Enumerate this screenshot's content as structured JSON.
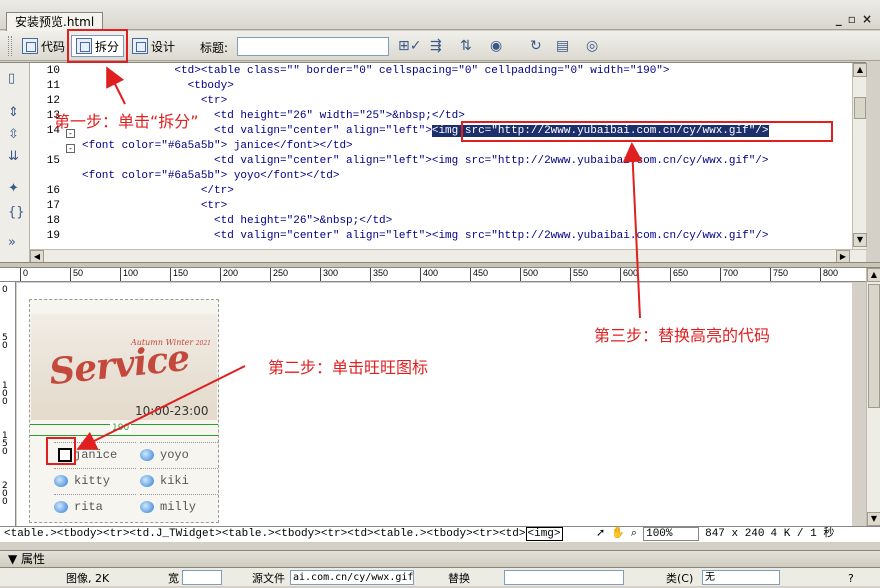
{
  "document": {
    "tab_title": "安装预览.html"
  },
  "window_controls": [
    "_",
    "▫",
    "×"
  ],
  "toolbar": {
    "code_label": "代码",
    "split_label": "拆分",
    "design_label": "设计",
    "title_label": "标题:",
    "title_value": ""
  },
  "code": {
    "lines": [
      {
        "num": "10",
        "text": "              <td><table class=\"\" border=\"0\" cellspacing=\"0\" cellpadding=\"0\" width=\"190\">"
      },
      {
        "num": "11",
        "text": "                <tbody>"
      },
      {
        "num": "12",
        "text": "                  <tr>"
      },
      {
        "num": "13",
        "text": "                    <td height=\"26\" width=\"25\">&nbsp;</td>"
      },
      {
        "num": "14",
        "text": "                    <td valign=\"center\" align=\"left\">",
        "highlight": "<img src=\"http://2www.yubaibai.com.cn/cy/wwx.gif\"/>"
      },
      {
        "num": "",
        "text": "<font color=\"#6a5a5b\"> janice</font></td>"
      },
      {
        "num": "15",
        "text": "                    <td valign=\"center\" align=\"left\"><img src=\"http://2www.yubaibai.com.cn/cy/wwx.gif\"/>"
      },
      {
        "num": "",
        "text": "<font color=\"#6a5a5b\"> yoyo</font></td>"
      },
      {
        "num": "16",
        "text": "                  </tr>"
      },
      {
        "num": "17",
        "text": "                  <tr>"
      },
      {
        "num": "18",
        "text": "                    <td height=\"26\">&nbsp;</td>"
      },
      {
        "num": "19",
        "text": "                    <td valign=\"center\" align=\"left\"><img src=\"http://2www.yubaibai.com.cn/cy/wwx.gif\"/>"
      }
    ]
  },
  "ruler": {
    "marks": [
      "0",
      "50",
      "100",
      "150",
      "200",
      "250",
      "300",
      "350",
      "400",
      "450",
      "500",
      "550",
      "600",
      "650",
      "700",
      "750",
      "800"
    ]
  },
  "ruler_v": {
    "marks": [
      "0",
      "50",
      "100",
      "150",
      "200"
    ]
  },
  "design": {
    "service": {
      "small": "Autumn Winter",
      "small_year": "2021",
      "big": "Service",
      "time": "10:00-23:00"
    },
    "width_label": "190",
    "names": [
      "janice",
      "yoyo",
      "kitty",
      "kiki",
      "rita",
      "milly"
    ]
  },
  "statusbar": {
    "tags": "<table.><tbody><tr><td.J_TWidget><table.><tbody><tr><td><table.><tbody><tr><td>",
    "selected_tag": "<img>",
    "zoom": "100%",
    "size": "847 x 240",
    "weight": "4 K / 1 秒"
  },
  "properties": {
    "header": "属性",
    "image_label": "图像, 2K",
    "width_label": "宽",
    "src_label": "源文件",
    "src_value": "ai.com.cn/cy/wwx.gif",
    "alt_label": "替换",
    "class_label": "类(C)",
    "class_value": "无"
  },
  "annotations": {
    "step1": "第一步：单击“拆分”",
    "step2": "第二步：单击旺旺图标",
    "step3": "第三步：替换高亮的代码"
  },
  "colors": {
    "annotation": "#e02020",
    "highlight_bg": "#1c2f6d",
    "code_text": "#000088"
  }
}
